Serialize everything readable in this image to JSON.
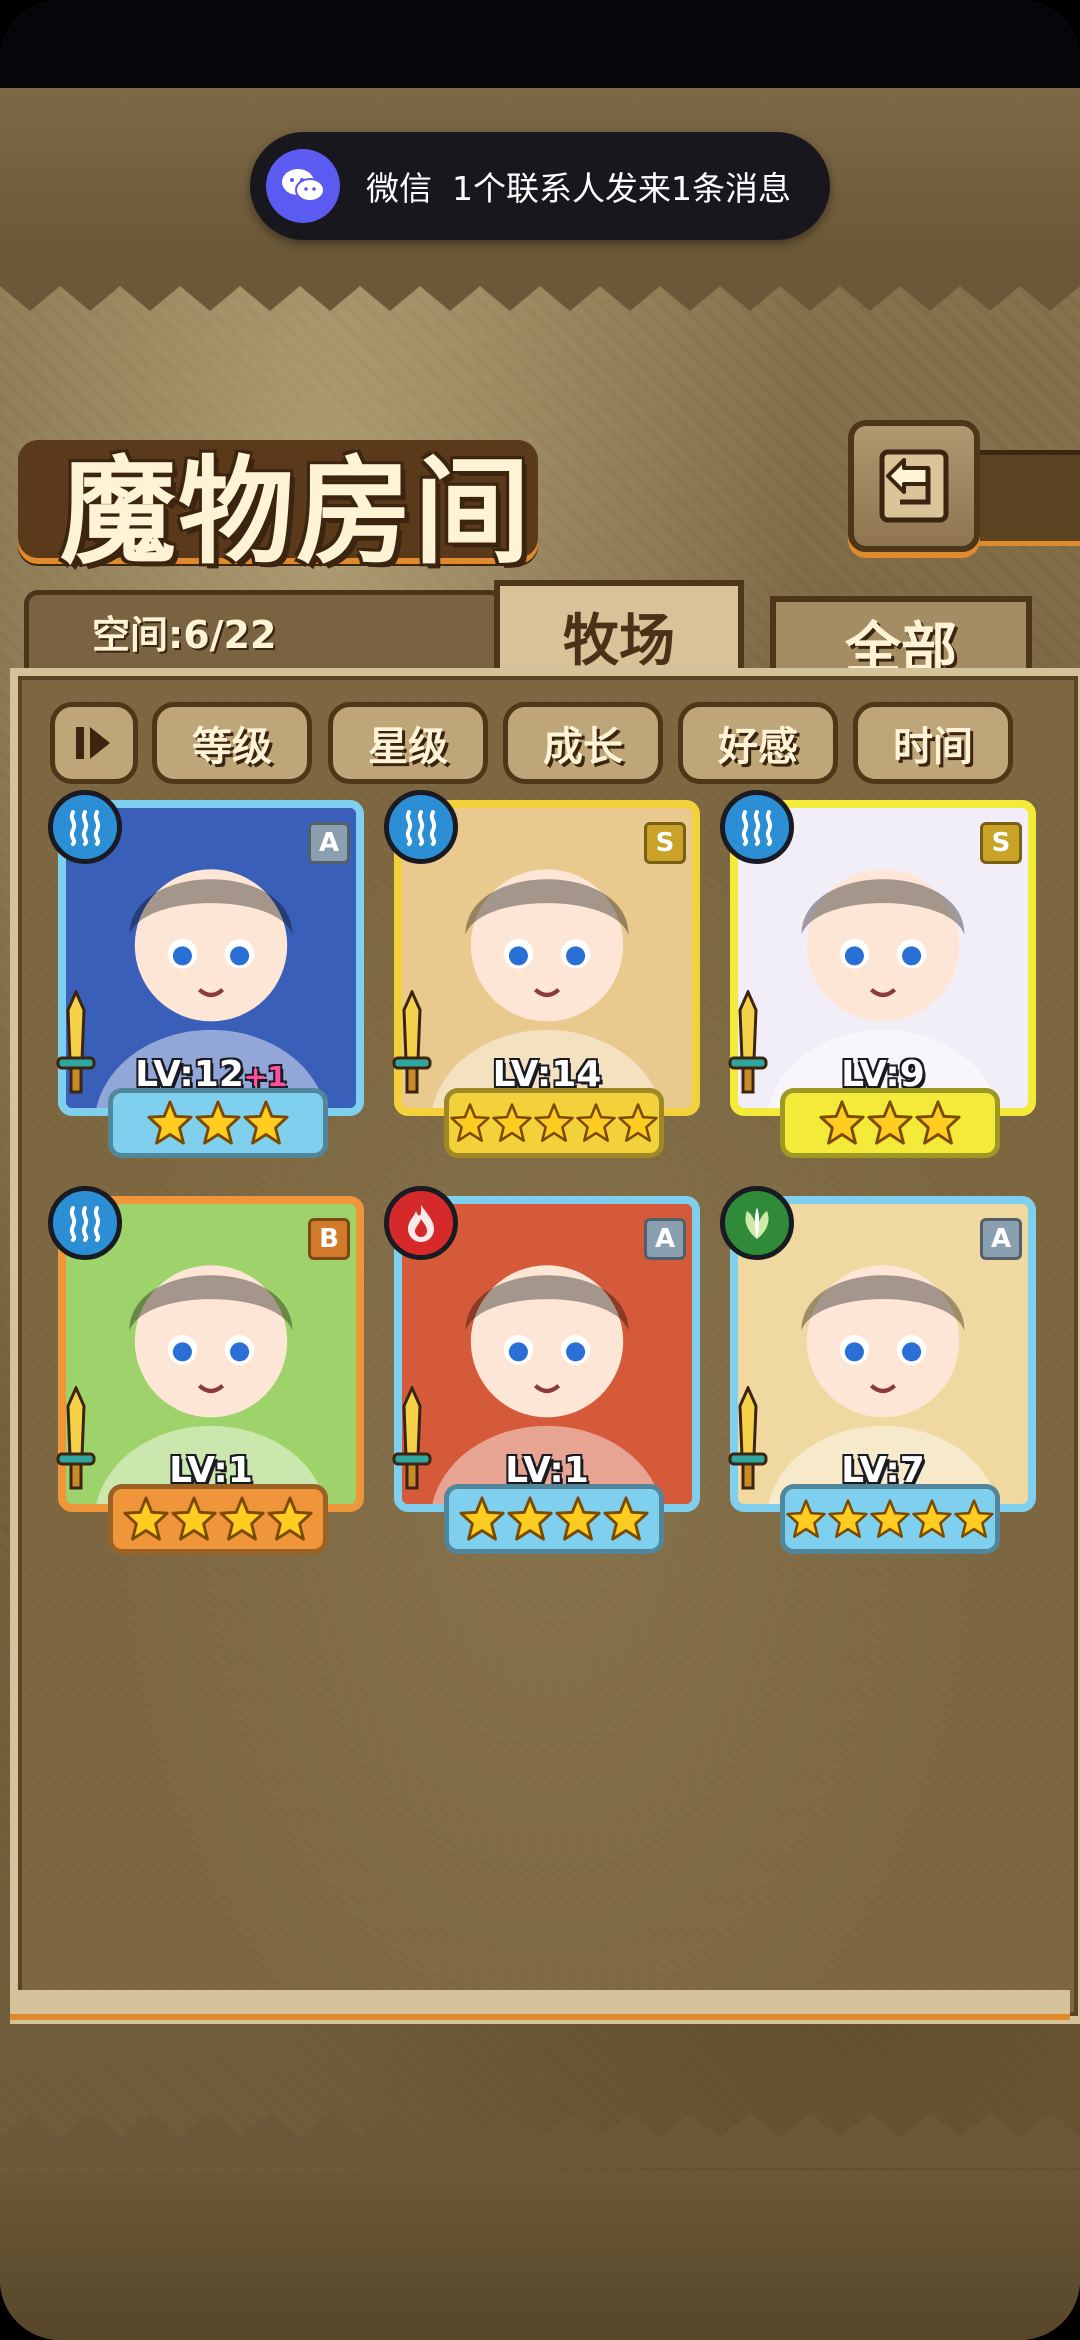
{
  "notification": {
    "app": "微信",
    "message": "1个联系人发来1条消息"
  },
  "header": {
    "title": "魔物房间",
    "back_icon": "back-arrow-icon"
  },
  "tabs": {
    "space_label": "空间:6/22",
    "active": "牧场",
    "inactive": "全部"
  },
  "sort": {
    "toggle_glyph": "Ⅱ▸",
    "options": [
      "等级",
      "星级",
      "成长",
      "好感",
      "时间"
    ]
  },
  "monsters": [
    {
      "rank": "A",
      "element": "water",
      "level": "LV:12",
      "bonus": "+1",
      "stars": 3,
      "frame": "#7fd0ef",
      "art": "#3a5fb8"
    },
    {
      "rank": "S",
      "element": "water",
      "level": "LV:14",
      "bonus": "",
      "stars": 5,
      "frame": "#f2d13a",
      "art": "#e9c98d"
    },
    {
      "rank": "S",
      "element": "water",
      "level": "LV:9",
      "bonus": "",
      "stars": 3,
      "frame": "#f3ea3a",
      "art": "#f2eef8"
    },
    {
      "rank": "B",
      "element": "water",
      "level": "LV:1",
      "bonus": "",
      "stars": 4,
      "frame": "#f0963a",
      "art": "#9ed36b"
    },
    {
      "rank": "A",
      "element": "fire",
      "level": "LV:1",
      "bonus": "",
      "stars": 4,
      "frame": "#7fd0ef",
      "art": "#d55a3a"
    },
    {
      "rank": "A",
      "element": "wood",
      "level": "LV:7",
      "bonus": "",
      "stars": 5,
      "frame": "#7fd0ef",
      "art": "#f0d9a0"
    }
  ],
  "colors": {
    "water": "#2c8fd6",
    "fire": "#d62a2a",
    "wood": "#2f8a3a",
    "star": "#ffcc22"
  }
}
